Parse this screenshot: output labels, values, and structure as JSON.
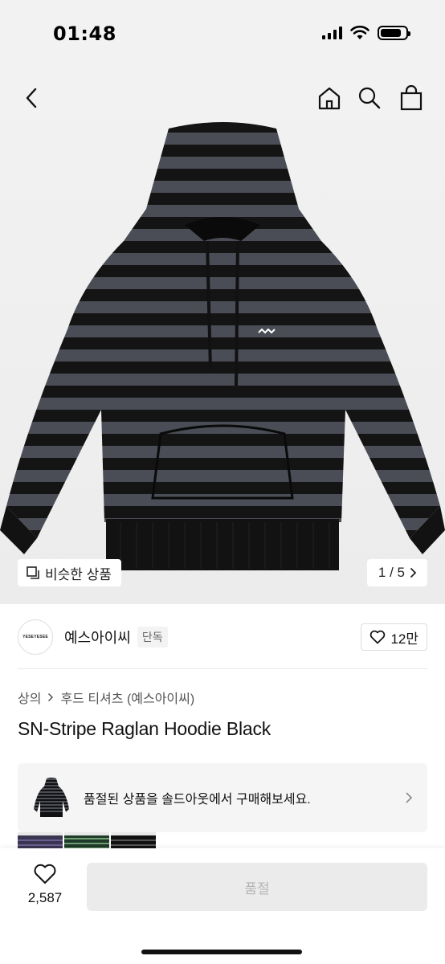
{
  "status_bar": {
    "time": "01:48"
  },
  "hero": {
    "similar_label": "비슷한 상품",
    "page_indicator": "1 / 5"
  },
  "brand": {
    "logo_text": "YESEYESEE",
    "name": "예스아이씨",
    "badge": "단독",
    "likes": "12만"
  },
  "breadcrumb": {
    "category": "상의",
    "subcategory": "후드 티셔츠 (예스아이씨)"
  },
  "product": {
    "title": "SN-Stripe Raglan Hoodie Black"
  },
  "soldout_banner": {
    "text": "품절된 상품을 솔드아웃에서 구매해보세요."
  },
  "bottom_bar": {
    "wish_count": "2,587",
    "buy_label": "품절"
  }
}
